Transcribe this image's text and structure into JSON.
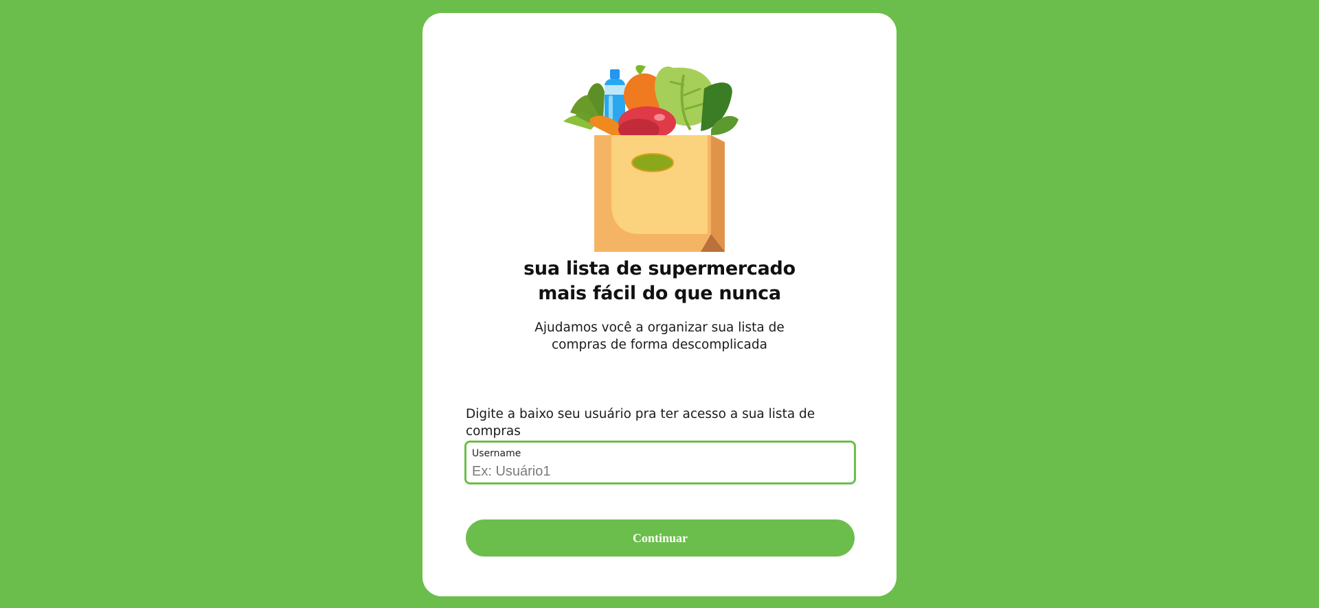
{
  "colors": {
    "background": "#6bbe4b",
    "card": "#ffffff",
    "accent": "#6bbe4b"
  },
  "illustration": {
    "icon": "grocery-bag-icon"
  },
  "heading": {
    "line1": "sua lista de supermercado",
    "line2": "mais fácil do que nunca"
  },
  "subheading": {
    "line1": "Ajudamos você a organizar sua lista de",
    "line2": "compras de forma descomplicada"
  },
  "form": {
    "instruction": "Digite a baixo seu usuário pra ter acesso a sua lista de compras",
    "username_label": "Username",
    "username_placeholder": "Ex: Usuário1",
    "username_value": "",
    "submit_label": "Continuar"
  }
}
